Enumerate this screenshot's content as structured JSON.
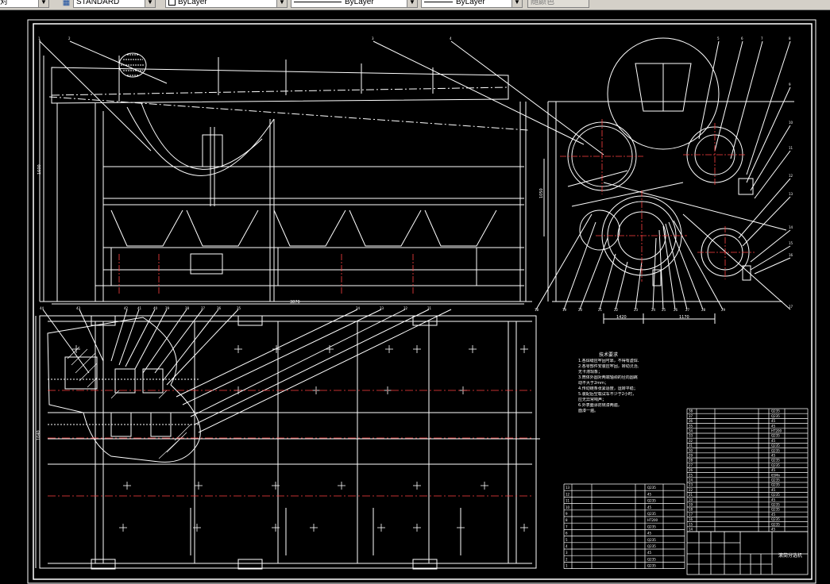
{
  "toolbar": {
    "plot_style_label": "对",
    "text_style_value": "STANDARD",
    "layer_color_value": "ByLayer",
    "linetype_value": "ByLayer",
    "lineweight_value": "ByLayer",
    "plot_style_value": "随颜色"
  },
  "drawing": {
    "top_view_balloons": [
      "1",
      "2",
      "3",
      "4",
      "5",
      "6",
      "7",
      "8",
      "9",
      "10",
      "11",
      "12",
      "13",
      "14",
      "15",
      "16",
      "17",
      "18",
      "19",
      "20",
      "21",
      "22",
      "23",
      "24",
      "25",
      "26",
      "27",
      "28",
      "29",
      "30",
      "31",
      "32",
      "33",
      "34",
      "35",
      "36",
      "37",
      "38"
    ],
    "bottom_view_balloons": [
      "44",
      "43",
      "42",
      "41",
      "40",
      "39",
      "38",
      "37",
      "36",
      "35",
      "34",
      "33",
      "32",
      "31"
    ],
    "dimensions": {
      "overall_length": "3870",
      "overall_height": "1600",
      "side_height": "1050",
      "side_width_left": "1420",
      "side_width_right": "1170",
      "plan_width": "1040"
    }
  },
  "technical_notes": {
    "title": "技术要求",
    "lines": [
      "1.各焊缝应牢固可靠，不得有虚焊、漏焊；",
      "2.各零部件安装应牢固，转动灵活，",
      "  无卡滞现象；",
      "3.筒体外圆对两端轴颈的径向圆跳",
      "  动不大于2mm；",
      "4.传动链条张紧适度，运转平稳；",
      "5.装配后空载试车不少于2小时，",
      "  应无异常响声；",
      "6.外表面涂防锈漆两遍，",
      "  面漆一遍。"
    ]
  },
  "parts_list_right": {
    "numbers": [
      "38",
      "37",
      "36",
      "35",
      "34",
      "33",
      "32",
      "31",
      "30",
      "29",
      "28",
      "27",
      "26",
      "25",
      "24",
      "23",
      "22",
      "21",
      "20",
      "19",
      "18",
      "17",
      "16",
      "15",
      "14"
    ],
    "materials": [
      "Q235",
      "Q235",
      "45",
      "45",
      "HT200",
      "Q235",
      "45",
      "Q235",
      "Q235",
      "45",
      "Q235",
      "Q235",
      "45",
      "65Mn",
      "Q235",
      "Q235",
      "45",
      "Q235",
      "45",
      "Q235",
      "Q235",
      "45",
      "Q235",
      "Q235",
      "45"
    ]
  },
  "parts_list_left": {
    "numbers": [
      "13",
      "12",
      "11",
      "10",
      "9",
      "8",
      "7",
      "6",
      "5",
      "4",
      "3",
      "2",
      "1"
    ],
    "materials": [
      "Q235",
      "45",
      "Q235",
      "45",
      "Q235",
      "HT200",
      "Q235",
      "45",
      "Q235",
      "Q235",
      "45",
      "Q235",
      "Q235"
    ]
  },
  "title_block": {
    "drawing_name": "滚筒分选机"
  }
}
